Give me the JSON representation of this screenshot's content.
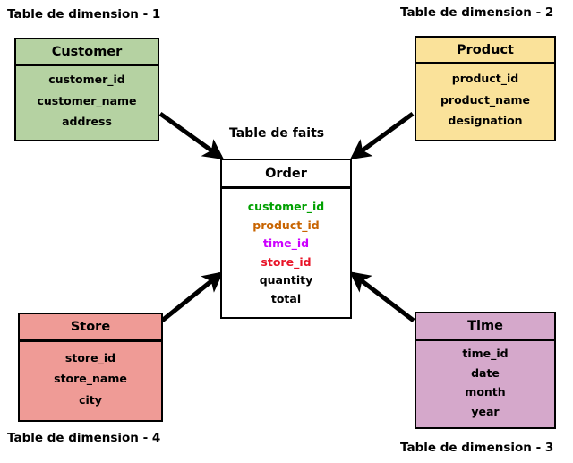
{
  "diagram": {
    "type": "star-schema",
    "fact_caption": "Table de faits",
    "captions": {
      "dim1": "Table de dimension - 1",
      "dim2": "Table de dimension - 2",
      "dim3": "Table de dimension - 3",
      "dim4": "Table de dimension - 4"
    },
    "colors": {
      "customer_fill": "#b5d2a2",
      "product_fill": "#fae29a",
      "store_fill": "#ef9b96",
      "time_fill": "#d5a8cb",
      "fact_fill": "#ffffff",
      "border": "#000000",
      "key_customer_id": "#00a000",
      "key_product_id": "#c86400",
      "key_time_id": "#cc00ff",
      "key_store_id": "#e81428",
      "measure": "#000000"
    },
    "tables": {
      "customer": {
        "name": "Customer",
        "fields": [
          "customer_id",
          "customer_name",
          "address"
        ]
      },
      "product": {
        "name": "Product",
        "fields": [
          "product_id",
          "product_name",
          "designation"
        ]
      },
      "store": {
        "name": "Store",
        "fields": [
          "store_id",
          "store_name",
          "city"
        ]
      },
      "time": {
        "name": "Time",
        "fields": [
          "time_id",
          "date",
          "month",
          "year"
        ]
      },
      "order": {
        "name": "Order",
        "fields": [
          {
            "label": "customer_id",
            "color": "#00a000"
          },
          {
            "label": "product_id",
            "color": "#c86400"
          },
          {
            "label": "time_id",
            "color": "#cc00ff"
          },
          {
            "label": "store_id",
            "color": "#e81428"
          },
          {
            "label": "quantity",
            "color": "#000000"
          },
          {
            "label": "total",
            "color": "#000000"
          }
        ]
      }
    },
    "relations": [
      {
        "from": "customer",
        "to": "order"
      },
      {
        "from": "product",
        "to": "order"
      },
      {
        "from": "store",
        "to": "order"
      },
      {
        "from": "time",
        "to": "order"
      }
    ]
  }
}
